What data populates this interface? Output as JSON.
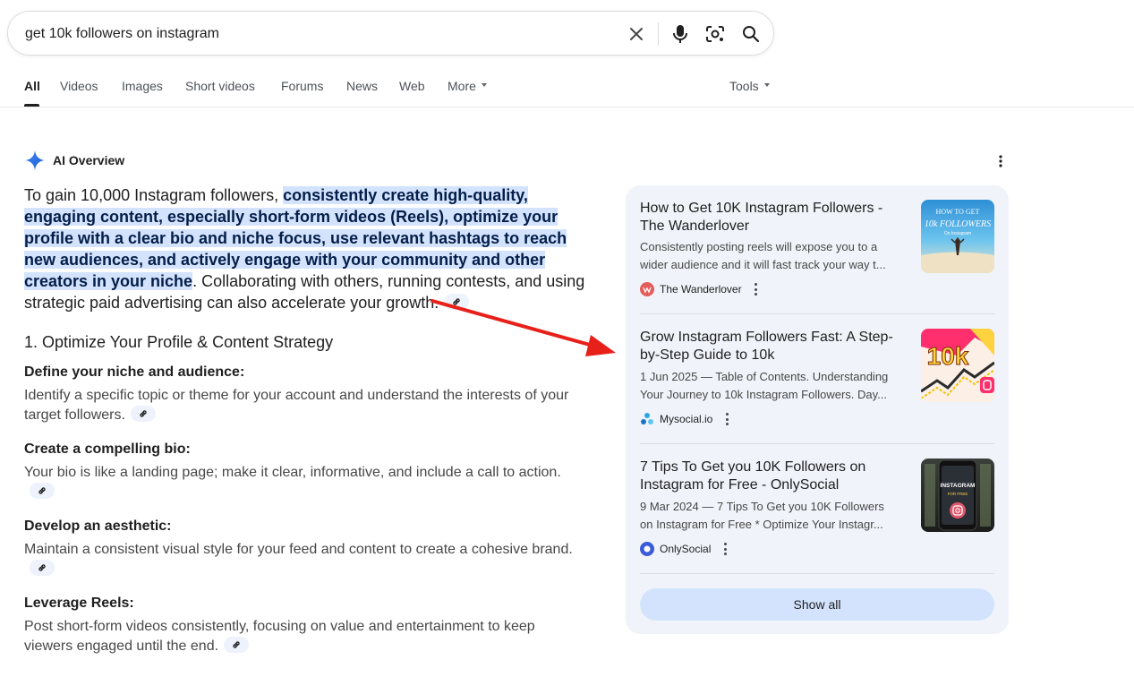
{
  "search": {
    "query": "get 10k followers on instagram",
    "clear_icon": "close-icon",
    "voice_icon": "microphone-icon",
    "lens_icon": "camera-lens-icon",
    "search_icon": "search-icon"
  },
  "tabs": {
    "items": [
      "All",
      "Videos",
      "Images",
      "Short videos",
      "Forums",
      "News",
      "Web",
      "More"
    ],
    "active": "All",
    "tools": "Tools"
  },
  "ai_overview": {
    "title": "AI Overview",
    "intro_plain_1": "To gain 10,000 Instagram followers, ",
    "intro_highlight": "consistently create high-quality, engaging content, especially short-form videos (Reels), optimize your profile with a clear bio and niche focus, use relevant hashtags to reach new audiences, and actively engage with your community and other creators in your niche",
    "intro_plain_2": ". Collaborating with others, running contests, and using strategic paid advertising can also accelerate your growth.",
    "section_title": "1. Optimize Your Profile & Content Strategy",
    "items": [
      {
        "heading": "Define your niche and audience:",
        "text": "Identify a specific topic or theme for your account and understand the interests of your target followers."
      },
      {
        "heading": "Create a compelling bio:",
        "text": "Your bio is like a landing page; make it clear, informative, and include a call to action."
      },
      {
        "heading": "Develop an aesthetic:",
        "text": "Maintain a consistent visual style for your feed and content to create a cohesive brand."
      },
      {
        "heading": "Leverage Reels:",
        "text": "Post short-form videos consistently, focusing on value and entertainment to keep viewers engaged until the end."
      }
    ]
  },
  "sources": {
    "cards": [
      {
        "title": "How to Get 10K Instagram Followers - The Wanderlover",
        "snippet_1": "Consistently posting reels will expose you to a",
        "snippet_2": "wider audience and it will fast track your way t...",
        "source": "The Wanderlover",
        "thumb_line1": "HOW TO GET",
        "thumb_line2": "10k FOLLOWERS",
        "thumb_line3": "On Instagram"
      },
      {
        "title": "Grow Instagram Followers Fast: A Step-by-Step Guide to 10k",
        "snippet_1": "1 Jun 2025 — Table of Contents. Understanding",
        "snippet_2": "Your Journey to 10k Instagram Followers. Day...",
        "source": "Mysocial.io",
        "thumb_line1": "10k"
      },
      {
        "title": "7 Tips To Get you 10K Followers on Instagram for Free - OnlySocial",
        "snippet_1": "9 Mar 2024 — 7 Tips To Get you 10K Followers",
        "snippet_2": "on Instagram for Free * Optimize Your Instagr...",
        "source": "OnlySocial",
        "thumb_line1": "INSTAGRAM",
        "thumb_line2": "FOR FREE"
      }
    ],
    "show_all": "Show all"
  },
  "colors": {
    "highlight": "#d3e3fd",
    "panel_bg": "#f0f4fa",
    "arrow": "#e8201a",
    "link": "#1a0dab"
  }
}
